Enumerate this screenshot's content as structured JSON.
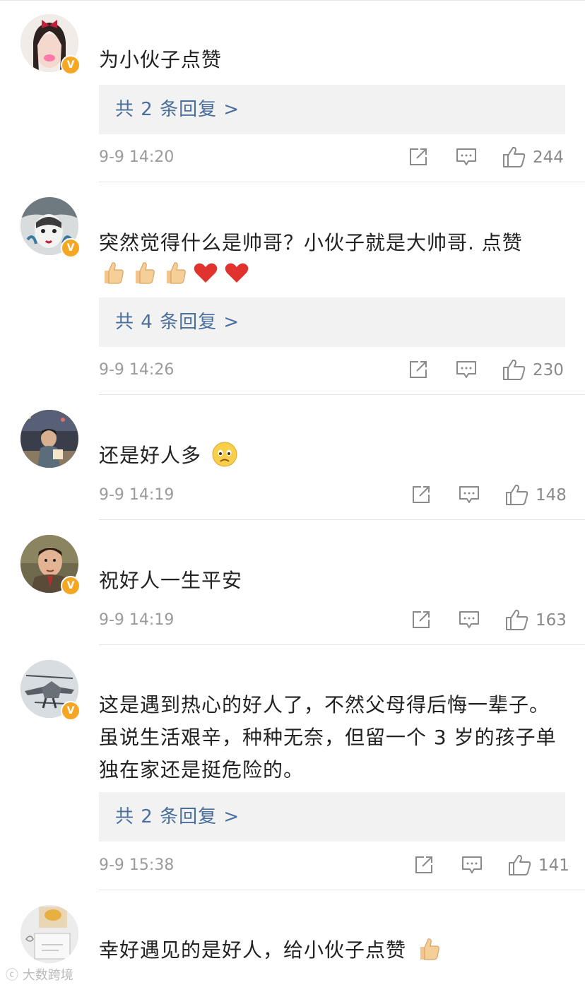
{
  "comments": [
    {
      "text": "为小伙子点赞",
      "replies": "共 2 条回复 >",
      "time": "9-9 14:20",
      "likes": "244"
    },
    {
      "text": "突然觉得什么是帅哥？小伙子就是大帅哥. 点赞",
      "replies": "共 4 条回复 >",
      "time": "9-9 14:26",
      "likes": "230"
    },
    {
      "text": "还是好人多",
      "time": "9-9 14:19",
      "likes": "148"
    },
    {
      "text": "祝好人一生平安",
      "time": "9-9 14:19",
      "likes": "163"
    },
    {
      "text": "这是遇到热心的好人了，不然父母得后悔一辈子。虽说生活艰辛，种种无奈，但留一个 3 岁的孩子单独在家还是挺危险的。",
      "replies": "共 2 条回复 >",
      "time": "9-9 15:38",
      "likes": "141"
    },
    {
      "text": "幸好遇见的是好人，给小伙子点赞"
    }
  ],
  "watermark": "大数跨境",
  "colors": {
    "reply_link": "#4a6f9c",
    "badge": "#f5a623",
    "meta": "#9b9b9b"
  },
  "icons": [
    "repost-icon",
    "comment-icon",
    "thumbs-up-icon",
    "verified-badge-icon"
  ]
}
